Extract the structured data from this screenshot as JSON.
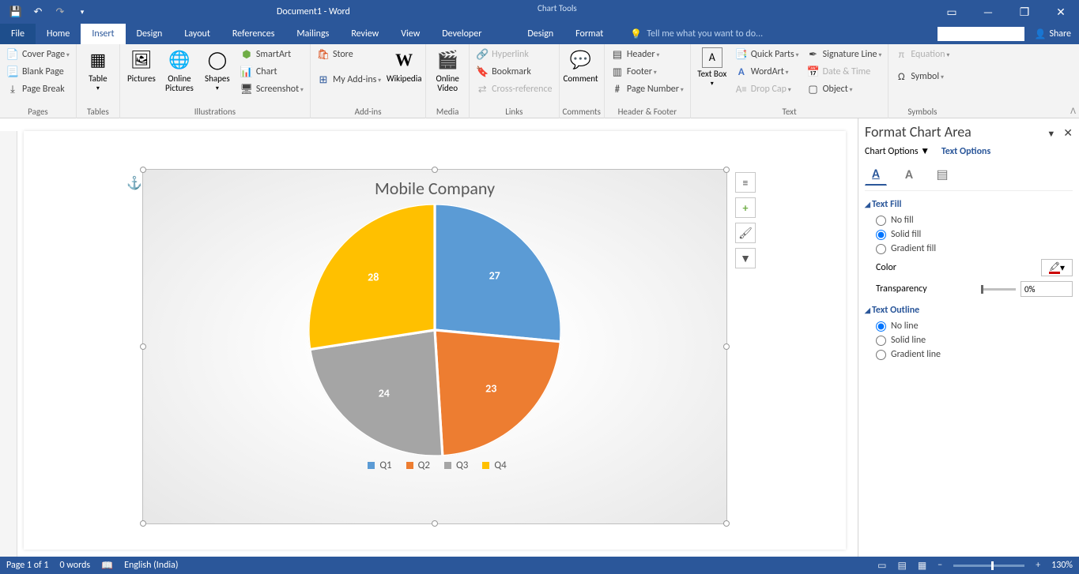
{
  "title": "Document1 - Word",
  "chart_tools_label": "Chart Tools",
  "tabs": [
    "File",
    "Home",
    "Insert",
    "Design",
    "Layout",
    "References",
    "Mailings",
    "Review",
    "View",
    "Developer"
  ],
  "active_tab": "Insert",
  "context_tabs": [
    "Design",
    "Format"
  ],
  "tell_me": "Tell me what you want to do...",
  "share": "Share",
  "ribbon": {
    "pages": {
      "cover": "Cover Page",
      "blank": "Blank Page",
      "break": "Page Break",
      "label": "Pages"
    },
    "tables": {
      "table": "Table",
      "label": "Tables"
    },
    "illus": {
      "pictures": "Pictures",
      "online": "Online Pictures",
      "shapes": "Shapes",
      "smartart": "SmartArt",
      "chart": "Chart",
      "screenshot": "Screenshot",
      "label": "Illustrations"
    },
    "addins": {
      "store": "Store",
      "my": "My Add-ins",
      "wiki": "Wikipedia",
      "label": "Add-ins"
    },
    "media": {
      "video": "Online Video",
      "label": "Media"
    },
    "links": {
      "hyper": "Hyperlink",
      "book": "Bookmark",
      "cross": "Cross-reference",
      "label": "Links"
    },
    "comments": {
      "comment": "Comment",
      "label": "Comments"
    },
    "hf": {
      "header": "Header",
      "footer": "Footer",
      "page": "Page Number",
      "label": "Header & Footer"
    },
    "text": {
      "box": "Text Box",
      "quick": "Quick Parts",
      "wordart": "WordArt",
      "drop": "Drop Cap",
      "sig": "Signature Line",
      "date": "Date & Time",
      "obj": "Object",
      "label": "Text"
    },
    "symbols": {
      "eq": "Equation",
      "sym": "Symbol",
      "label": "Symbols"
    }
  },
  "chart_data": {
    "type": "pie",
    "title": "Mobile Company",
    "categories": [
      "Q1",
      "Q2",
      "Q3",
      "Q4"
    ],
    "values": [
      27,
      23,
      24,
      28
    ],
    "colors": [
      "#5b9bd5",
      "#ed7d31",
      "#a5a5a5",
      "#ffc000"
    ]
  },
  "pane": {
    "title": "Format Chart Area",
    "chart_options": "Chart Options",
    "text_options": "Text Options",
    "text_fill": "Text Fill",
    "no_fill": "No fill",
    "solid_fill": "Solid fill",
    "gradient_fill": "Gradient fill",
    "color": "Color",
    "transparency": "Transparency",
    "transparency_val": "0%",
    "text_outline": "Text Outline",
    "no_line": "No line",
    "solid_line": "Solid line",
    "gradient_line": "Gradient line"
  },
  "status": {
    "page": "Page 1 of 1",
    "words": "0 words",
    "lang": "English (India)",
    "zoom": "130%"
  }
}
